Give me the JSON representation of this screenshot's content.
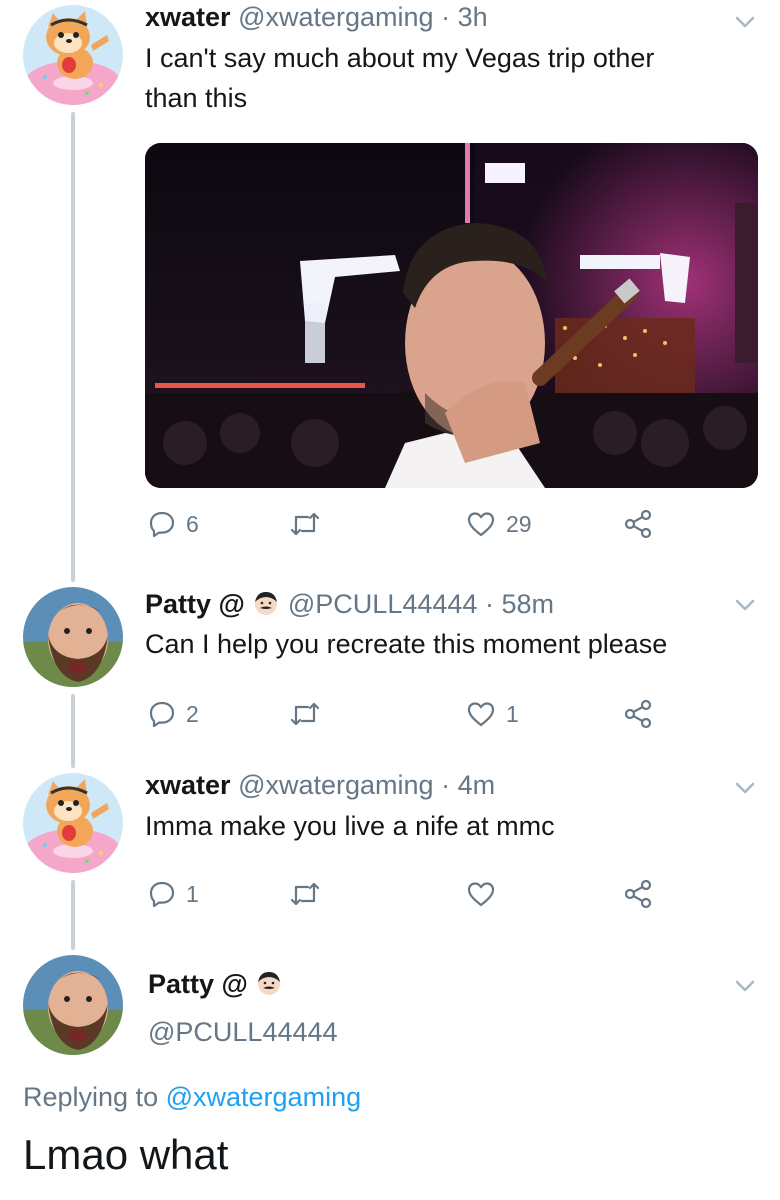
{
  "tweets": [
    {
      "display_name": "xwater",
      "handle": "@xwatergaming",
      "separator": "·",
      "time": "3h",
      "text_line1": "I can't say much about my Vegas trip other",
      "text_line2": "than this",
      "replies": "6",
      "retweets": "",
      "likes": "29"
    },
    {
      "display_name": "Patty @",
      "handle": "@PCULL44444",
      "separator": "·",
      "time": "58m",
      "text": "Can I help you recreate this moment please",
      "replies": "2",
      "retweets": "",
      "likes": "1"
    },
    {
      "display_name": "xwater",
      "handle": "@xwatergaming",
      "separator": "·",
      "time": "4m",
      "text": "Imma make you live a nife at mmc",
      "replies": "1",
      "retweets": "",
      "likes": ""
    }
  ],
  "focused_tweet": {
    "display_name": "Patty @",
    "handle": "@PCULL44444",
    "replying_prefix": "Replying to",
    "replying_to": "@xwatergaming",
    "text": "Lmao what"
  },
  "colors": {
    "link": "#1da1f2",
    "secondary_text": "#657786",
    "thread_line": "#c7d1d9"
  },
  "icons": [
    "reply-icon",
    "retweet-icon",
    "like-icon",
    "share-icon",
    "chevron-down-icon",
    "face-emoji-icon"
  ]
}
